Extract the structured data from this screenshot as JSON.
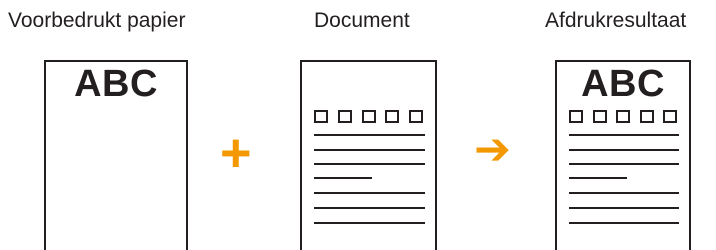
{
  "labels": {
    "preprinted": "Voorbedrukt papier",
    "document": "Document",
    "result": "Afdrukresultaat"
  },
  "preprinted_text": "ABC",
  "result_text": "ABC",
  "operators": {
    "plus": "+",
    "arrow": "➔"
  },
  "colors": {
    "accent": "#f39800",
    "ink": "#231f20"
  }
}
